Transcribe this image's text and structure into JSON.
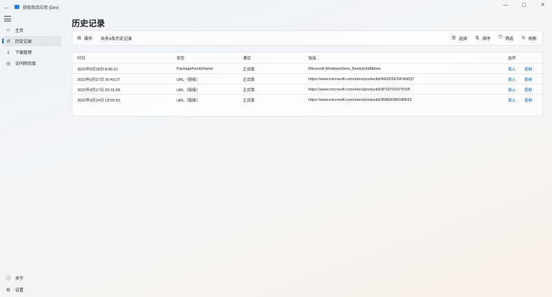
{
  "window": {
    "back_glyph": "←",
    "title": "获取商店应用 (Dev)",
    "app_icon": "store-bag-icon",
    "controls": [
      "—",
      "▢",
      "✕"
    ]
  },
  "sidebar": {
    "items": [
      {
        "label": "主页",
        "icon": "home-icon",
        "glyph": "⌂"
      },
      {
        "label": "历史记录",
        "icon": "history-icon",
        "glyph": "↺"
      },
      {
        "label": "下载管理",
        "icon": "download-icon",
        "glyph": "⤓"
      },
      {
        "label": "访问网页版",
        "icon": "globe-icon",
        "glyph": "◎"
      }
    ],
    "footer": [
      {
        "label": "关于",
        "icon": "info-icon",
        "glyph": "ⓘ"
      },
      {
        "label": "设置",
        "icon": "settings-icon",
        "glyph": "⚙"
      }
    ]
  },
  "main": {
    "title": "历史记录",
    "toolbar": {
      "operate_label": "操作",
      "operate_glyph": "⊞",
      "count_text": "共有4条历史记录",
      "select_label": "选择",
      "select_glyph": "☰",
      "sort_label": "排序",
      "sort_glyph": "⇅",
      "filter_label": "筛选",
      "filter_glyph": "⛉",
      "refresh_label": "刷新",
      "refresh_glyph": "↻"
    },
    "table": {
      "headers": {
        "time": "时间",
        "type": "类型",
        "channel": "通道",
        "link": "链接",
        "option": "选项"
      },
      "rows": [
        {
          "time": "2022年9月18日 8:46:22",
          "type": "PackageFamilyName",
          "channel": "正式版",
          "link": "Microsoft.WindowsStore_8wekyb3d8bbwe",
          "fill": "填入",
          "copy": "复制"
        },
        {
          "time": "2022年9月17日 20:43:27",
          "type": "URL（链接）",
          "channel": "正式版",
          "link": "https://www.microsoft.com/store/productid/9WZDNCRFHWQT",
          "fill": "填入",
          "copy": "复制"
        },
        {
          "time": "2022年9月17日 20:31:58",
          "type": "URL（链接）",
          "channel": "正式版",
          "link": "https://www.microsoft.com/store/productid/9P16TDXV7KSP",
          "fill": "填入",
          "copy": "复制"
        },
        {
          "time": "2022年9月14日 18:55:59",
          "type": "URL（链接）",
          "channel": "正式版",
          "link": "https://www.microsoft.com/store/productid/9NBW3BKNBK93",
          "fill": "填入",
          "copy": "复制"
        }
      ]
    }
  }
}
